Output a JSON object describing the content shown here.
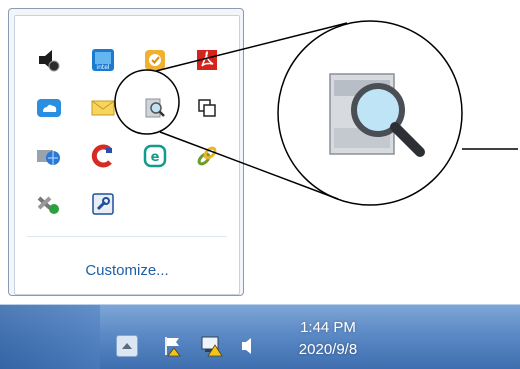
{
  "tray_popup": {
    "icons": [
      {
        "name": "speaker-app-icon"
      },
      {
        "name": "intel-graphics-icon"
      },
      {
        "name": "backup-app-icon"
      },
      {
        "name": "adobe-acrobat-icon"
      },
      {
        "name": "onedrive-cloud-icon"
      },
      {
        "name": "mail-envelope-icon"
      },
      {
        "name": "scanner-search-icon"
      },
      {
        "name": "windows-copy-icon"
      },
      {
        "name": "network-globe-icon"
      },
      {
        "name": "ccleaner-icon"
      },
      {
        "name": "eset-icon"
      },
      {
        "name": "chain-link-icon"
      },
      {
        "name": "network-cable-icon"
      },
      {
        "name": "wrench-tool-icon"
      }
    ],
    "customize_label": "Customize..."
  },
  "callout": {
    "zoomed_icon": "scanner-search-icon"
  },
  "taskbar": {
    "show_hidden_icons": "chevron-up-icon",
    "tray_icons": [
      "action-center-flag-icon",
      "network-warning-icon",
      "volume-icon"
    ],
    "clock_time": "1:44 PM",
    "clock_date": "2020/9/8"
  },
  "colors": {
    "link": "#1f5fa8",
    "taskbar": "#4f7fbf",
    "popup_border": "#8b9bb3"
  }
}
